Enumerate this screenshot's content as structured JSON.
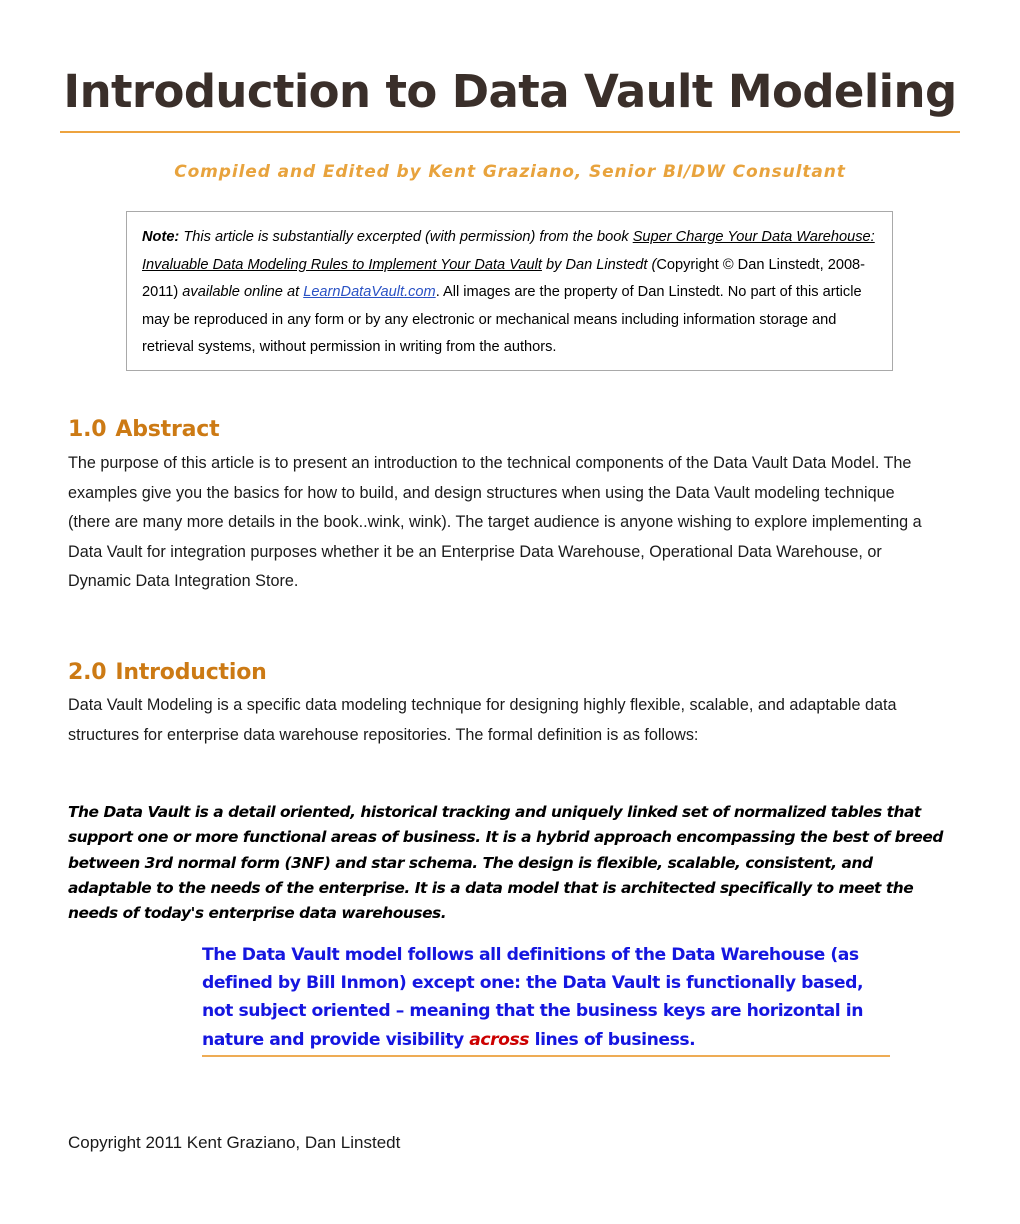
{
  "document": {
    "title": "Introduction to Data Vault Modeling",
    "subtitle": "Compiled and Edited by Kent Graziano, Senior BI/DW Consultant",
    "footer": "Copyright 2011 Kent Graziano, Dan Linstedt"
  },
  "note": {
    "label": "Note:",
    "text_1": " This article is substantially excerpted (with permission) from the book ",
    "book_title": "Super Charge Your Data Warehouse: Invaluable Data Modeling Rules to Implement Your Data Vault",
    "text_2": " by Dan Linstedt (",
    "copyright": "Copyright © Dan Linstedt, 2008-2011)",
    "text_3": " available online at ",
    "link": "LearnDataVault.com",
    "text_4": ". All images are the property of Dan Linstedt. No part of this article may be reproduced in any form or by any electronic or mechanical means including information storage and retrieval systems, without permission in writing from the authors."
  },
  "sections": {
    "abstract": {
      "number": "1.0",
      "heading": "Abstract",
      "body": "The purpose of this article is to present an introduction to the technical components of the Data Vault Data Model.  The examples give you the basics for how to build, and design structures when using the Data Vault modeling technique (there are many more details in the book..wink, wink). The target audience is anyone wishing to explore implementing a Data Vault for integration purposes whether it be an Enterprise Data Warehouse, Operational Data Warehouse, or Dynamic Data Integration Store."
    },
    "introduction": {
      "number": "2.0",
      "heading": "Introduction",
      "body": "Data Vault Modeling is a specific data modeling technique for designing highly flexible, scalable, and adaptable data structures for enterprise data warehouse repositories. The formal definition is as follows:",
      "definition": "The Data Vault is a detail oriented, historical tracking and uniquely linked set of normalized tables that support one or more functional areas of business. It is a hybrid approach encompassing the best of breed between 3rd normal form (3NF) and star schema. The design is flexible, scalable, consistent, and adaptable to the needs of the enterprise. It is a data model that is architected specifically to meet the needs of today's enterprise data warehouses.",
      "callout_part_1": "The Data Vault model follows all definitions of the Data Warehouse (as defined by Bill Inmon) except one: the Data Vault is functionally based, not subject oriented – meaning that the business keys are horizontal in nature and provide visibility ",
      "callout_emphasis": "across",
      "callout_part_2": " lines of business."
    }
  },
  "colors": {
    "title": "#3a2f2a",
    "rule": "#eda33f",
    "subtitle": "#e8a33d",
    "heading": "#cc7a14",
    "callout_blue": "#1516e0",
    "emphasis_red": "#cc0000",
    "link_blue": "#2a52c4",
    "note_border": "#a9a9a9"
  }
}
